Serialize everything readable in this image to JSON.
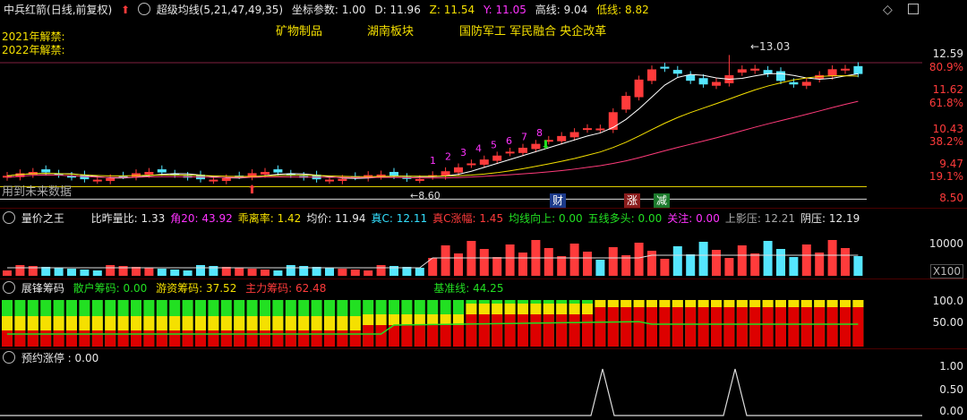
{
  "main_header": {
    "stock": "中兵红箭",
    "period": "(日线,前复权)",
    "indicator": "超级均线(5,21,47,49,35)",
    "coord_label": "坐标参数:",
    "coord_value": "1.00",
    "d_label": "D:",
    "d_value": "11.96",
    "z_label": "Z:",
    "z_value": "11.54",
    "y_label": "Y:",
    "y_value": "11.05",
    "high_label": "高线:",
    "high_value": "9.04",
    "low_label": "低线:",
    "low_value": "8.82"
  },
  "ban_notes": [
    "2021年解禁:",
    "2022年解禁:"
  ],
  "concepts": [
    "矿物制品",
    "湖南板块",
    "国防军工 军民融合 央企改革"
  ],
  "price_axis": [
    "12.59",
    "80.9%",
    "11.62",
    "61.8%",
    "10.43",
    "38.2%",
    "9.47",
    "19.1%",
    "8.50"
  ],
  "annotations": {
    "peak": "13.03",
    "trough": "8.60",
    "future": "用到未来数据",
    "tags": [
      "财",
      "涨",
      "减"
    ],
    "counts": [
      "1",
      "2",
      "3",
      "4",
      "5",
      "6",
      "7",
      "8"
    ]
  },
  "volume_header": {
    "name": "量价之王",
    "items": [
      {
        "label": "比昨量比:",
        "value": "1.33",
        "color": "#e8e8e8"
      },
      {
        "label": "角20:",
        "value": "43.92",
        "color": "#ff33ff"
      },
      {
        "label": "乖离率:",
        "value": "1.42",
        "color": "#f5e000"
      },
      {
        "label": "均价:",
        "value": "11.94",
        "color": "#e8e8e8"
      },
      {
        "label": "真C:",
        "value": "12.11",
        "color": "#33e0ff"
      },
      {
        "label": "真C涨幅:",
        "value": "1.45",
        "color": "#ff3b3b"
      },
      {
        "label": "均线向上:",
        "value": "0.00",
        "color": "#22e022"
      },
      {
        "label": "五线多头:",
        "value": "0.00",
        "color": "#22e022"
      },
      {
        "label": "关注:",
        "value": "0.00",
        "color": "#ff33ff"
      },
      {
        "label": "上影压:",
        "value": "12.21",
        "color": "#aaaaaa"
      },
      {
        "label": "阴压:",
        "value": "12.19",
        "color": "#e8e8e8"
      }
    ],
    "axis_value": "10000",
    "unit": "X100"
  },
  "chip_header": {
    "name": "展锋筹码",
    "retail_label": "散户筹码:",
    "retail_value": "0.00",
    "hot_label": "游资筹码:",
    "hot_value": "37.52",
    "main_label": "主力筹码:",
    "main_value": "62.48",
    "base_label": "基准线:",
    "base_value": "44.25",
    "axis": [
      "100.0",
      "50.00"
    ]
  },
  "limit_header": {
    "name": "预约涨停",
    "value": ": 0.00",
    "axis": [
      "1.00",
      "0.50",
      "0.00"
    ]
  },
  "colors": {
    "up": "#ff3b3b",
    "down": "#55e6ff",
    "ma_white": "#ffffff",
    "ma_yellow": "#f5e000",
    "ma_pink": "#ff3b7a",
    "chip_green": "#22e022",
    "chip_yellow": "#f5e000",
    "chip_red": "#dd0000"
  }
}
